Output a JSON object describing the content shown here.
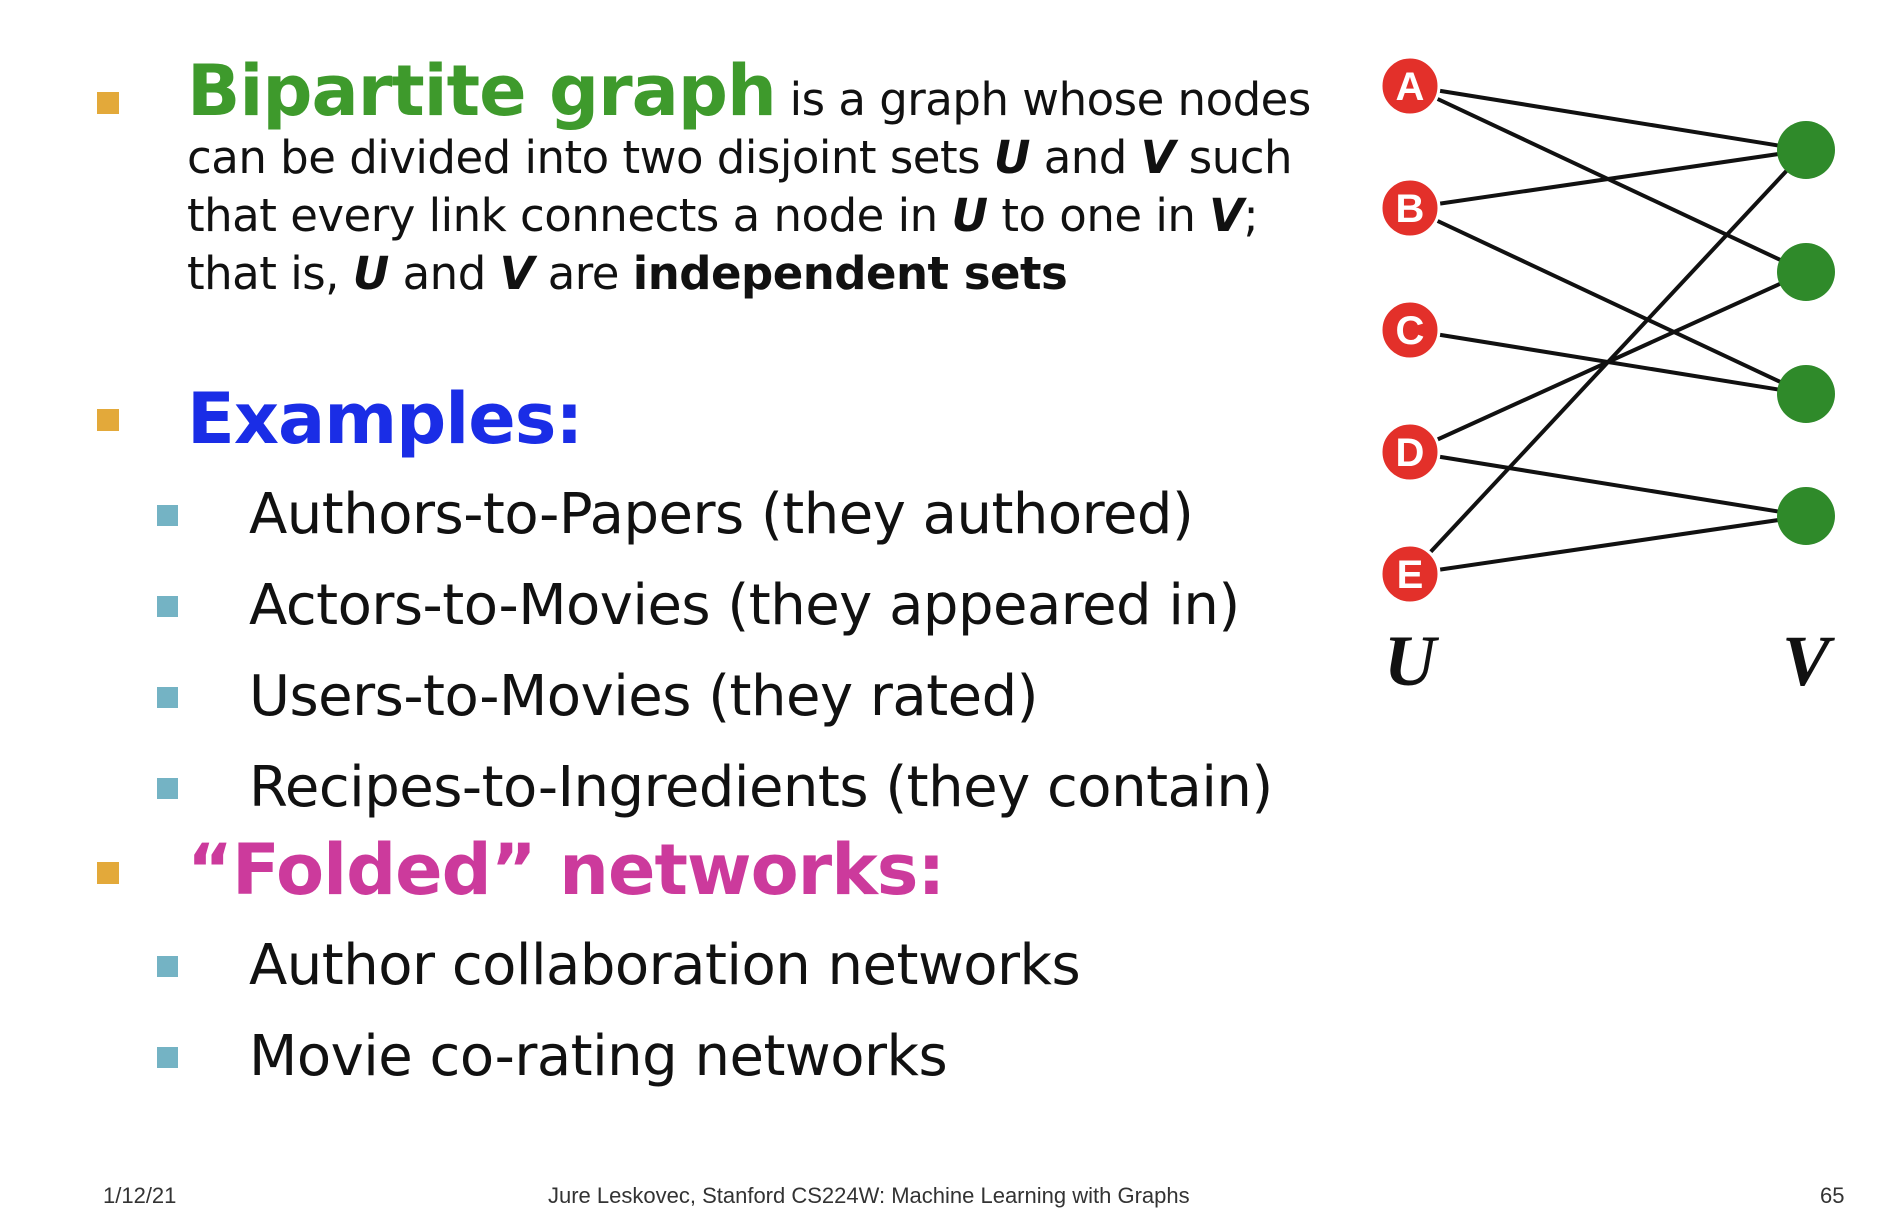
{
  "definition": {
    "term": "Bipartite graph",
    "text1": " is a graph whose nodes can be divided into two disjoint sets ",
    "u1": "U",
    "text2": " and ",
    "v1": "V",
    "text3": " such that every link connects a node in ",
    "u2": "U",
    "text4": " to one in ",
    "v2": "V",
    "text5": "; that is, ",
    "u3": "U",
    "text6": " and ",
    "v3": "V",
    "text7": " are ",
    "emph": "independent sets"
  },
  "examples": {
    "heading": "Examples:",
    "items": [
      "Authors-to-Papers (they authored)",
      "Actors-to-Movies (they appeared in)",
      "Users-to-Movies (they rated)",
      "Recipes-to-Ingredients (they contain)"
    ]
  },
  "folded": {
    "heading": "“Folded” networks:",
    "items": [
      "Author collaboration networks",
      "Movie co-rating networks"
    ]
  },
  "graph": {
    "u_nodes": [
      "A",
      "B",
      "C",
      "D",
      "E"
    ],
    "v_node_count": 4,
    "edges": [
      [
        0,
        0
      ],
      [
        0,
        1
      ],
      [
        1,
        0
      ],
      [
        1,
        2
      ],
      [
        2,
        2
      ],
      [
        3,
        1
      ],
      [
        3,
        3
      ],
      [
        4,
        0
      ],
      [
        4,
        3
      ]
    ],
    "u_label": "U",
    "v_label": "V",
    "u_color": "#e3302a",
    "v_color": "#2f8a2a"
  },
  "footer": {
    "date": "1/12/21",
    "center": "Jure Leskovec, Stanford CS224W: Machine Learning with Graphs",
    "page": "65"
  },
  "colors": {
    "term": "#3e9a2c",
    "examples_heading": "#1a2de6",
    "folded_heading": "#cc3a9c",
    "bullet": "#e3a93a",
    "sub_bullet": "#74b3c4"
  }
}
